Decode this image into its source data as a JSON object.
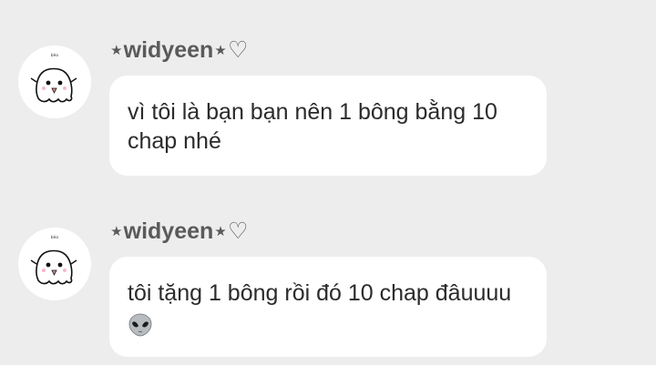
{
  "messages": [
    {
      "sender": "⋆widyeen⋆♡",
      "avatar_icon": "ghost-avatar-icon",
      "avatar_caption": "bèo",
      "text": "vì tôi là bạn bạn nên 1 bông bằng 10 chap nhé",
      "emoji": ""
    },
    {
      "sender": "⋆widyeen⋆♡",
      "avatar_icon": "ghost-avatar-icon",
      "avatar_caption": "bèo",
      "text": "tôi tặng 1 bông rồi đó 10 chap đâuuuu",
      "emoji": "alien-icon"
    }
  ],
  "colors": {
    "background": "#ededed",
    "bubble": "#ffffff",
    "sender_text": "#5a5a5a",
    "message_text": "#2b2b2b"
  }
}
